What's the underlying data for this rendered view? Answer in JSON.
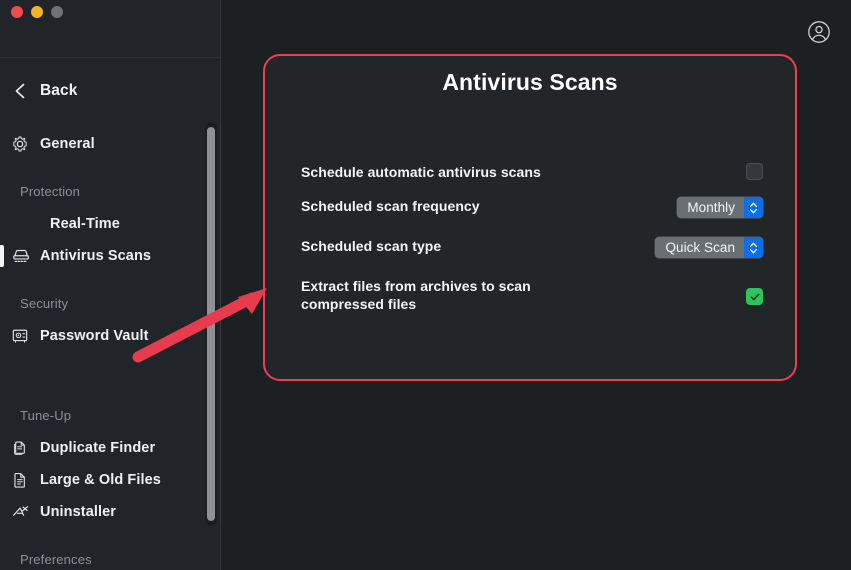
{
  "window": {
    "traffic_lights": [
      "close",
      "minimize",
      "zoom"
    ]
  },
  "sidebar": {
    "back_label": "Back",
    "back_icon": "chevron-left-icon",
    "items": [
      {
        "label": "General",
        "icon": "gear-icon",
        "type": "item",
        "selected": false
      },
      {
        "label": "Protection",
        "icon": "",
        "type": "group"
      },
      {
        "label": "Real-Time",
        "icon": "",
        "type": "item",
        "selected": false
      },
      {
        "label": "Antivirus Scans",
        "icon": "scanner-icon",
        "type": "item",
        "selected": true
      },
      {
        "label": "Security",
        "icon": "",
        "type": "group"
      },
      {
        "label": "Password Vault",
        "icon": "safe-icon",
        "type": "item",
        "selected": false
      },
      {
        "label": "Tune-Up",
        "icon": "",
        "type": "group"
      },
      {
        "label": "Duplicate Finder",
        "icon": "duplicate-files-icon",
        "type": "item",
        "selected": false
      },
      {
        "label": "Large & Old Files",
        "icon": "document-icon",
        "type": "item",
        "selected": false
      },
      {
        "label": "Uninstaller",
        "icon": "uninstall-icon",
        "type": "item",
        "selected": false
      },
      {
        "label": "Preferences",
        "icon": "",
        "type": "group"
      }
    ]
  },
  "topbar": {
    "account_icon": "user-circle-icon"
  },
  "panel": {
    "title": "Antivirus Scans",
    "highlight_color": "#ef3e52",
    "rows": [
      {
        "label": "Schedule automatic antivirus scans",
        "control": "checkbox",
        "checked": false
      },
      {
        "label": "Scheduled scan frequency",
        "control": "select",
        "value": "Monthly"
      },
      {
        "label": "Scheduled scan type",
        "control": "select",
        "value": "Quick Scan"
      },
      {
        "label": "Extract files from archives to scan compressed files",
        "control": "checkbox",
        "checked": true
      }
    ]
  },
  "annotation": {
    "type": "arrow",
    "color": "#e83b4e",
    "points_to": "antivirus-scans-panel"
  }
}
